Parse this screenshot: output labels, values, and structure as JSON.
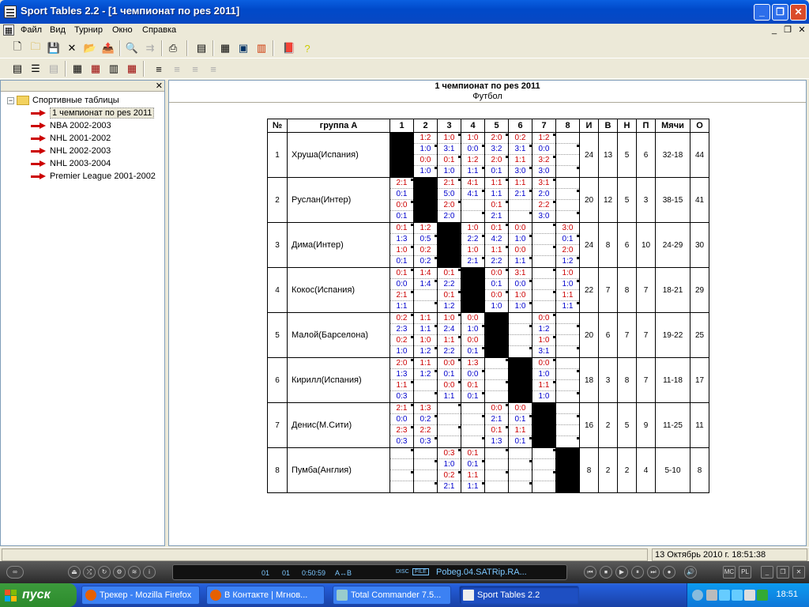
{
  "window": {
    "title": "Sport Tables 2.2 - [1 чемпионат по pes 2011]"
  },
  "menu": [
    "Файл",
    "Вид",
    "Турнир",
    "Окно",
    "Справка"
  ],
  "tree": {
    "root": "Спортивные таблицы",
    "items": [
      "1 чемпионат по pes 2011",
      "NBA 2002-2003",
      "NHL 2001-2002",
      "NHL 2002-2003",
      "NHL 2003-2004",
      "Premier League 2001-2002"
    ]
  },
  "doc": {
    "title": "1 чемпионат по pes 2011",
    "subtitle": "Футбол"
  },
  "table": {
    "headers": {
      "num": "№",
      "group": "группа А",
      "cols": [
        "1",
        "2",
        "3",
        "4",
        "5",
        "6",
        "7",
        "8"
      ],
      "games": "И",
      "wins": "В",
      "draws": "Н",
      "losses": "П",
      "goals": "Мячи",
      "points": "О"
    },
    "rows": [
      {
        "num": "1",
        "team": "Хруша(Испания)",
        "games": "24",
        "wins": "13",
        "draws": "5",
        "losses": "6",
        "goals": "32-18",
        "points": "44",
        "cells": [
          null,
          [
            "1:2",
            "1:0",
            "0:0",
            "1:0"
          ],
          [
            "1:0",
            "3:1",
            "0:1",
            "1:0"
          ],
          [
            "1:0",
            "0:0",
            "1:2",
            "1:1"
          ],
          [
            "2:0",
            "3:2",
            "2:0",
            "0:1"
          ],
          [
            "0:2",
            "3:1",
            "1:1",
            "3:0"
          ],
          [
            "1:2",
            "0:0",
            "3:2",
            "3:0"
          ],
          [
            "",
            "",
            "",
            ""
          ]
        ]
      },
      {
        "num": "2",
        "team": "Руслан(Интер)",
        "games": "20",
        "wins": "12",
        "draws": "5",
        "losses": "3",
        "goals": "38-15",
        "points": "41",
        "cells": [
          [
            "2:1",
            "0:1",
            "0:0",
            "0:1"
          ],
          null,
          [
            "2:1",
            "5:0",
            "2:0",
            "2:0"
          ],
          [
            "4:1",
            "4:1",
            "",
            ""
          ],
          [
            "1:1",
            "1:1",
            "0:1",
            "2:1"
          ],
          [
            "1:1",
            "2:1",
            "",
            ""
          ],
          [
            "3:1",
            "2:0",
            "2:2",
            "3:0"
          ],
          [
            "",
            "",
            "",
            ""
          ]
        ]
      },
      {
        "num": "3",
        "team": "Дима(Интер)",
        "games": "24",
        "wins": "8",
        "draws": "6",
        "losses": "10",
        "goals": "24-29",
        "points": "30",
        "cells": [
          [
            "0:1",
            "1:3",
            "1:0",
            "0:1"
          ],
          [
            "1:2",
            "0:5",
            "0:2",
            "0:2"
          ],
          null,
          [
            "1:0",
            "2:2",
            "1:0",
            "2:1"
          ],
          [
            "0:1",
            "4:2",
            "1:1",
            "2:2"
          ],
          [
            "0:0",
            "1:0",
            "0:0",
            "1:1"
          ],
          [
            "",
            "",
            "",
            ""
          ],
          [
            "3:0",
            "0:1",
            "2:0",
            "1:2"
          ]
        ]
      },
      {
        "num": "4",
        "team": "Кокос(Испания)",
        "games": "22",
        "wins": "7",
        "draws": "8",
        "losses": "7",
        "goals": "18-21",
        "points": "29",
        "cells": [
          [
            "0:1",
            "0:0",
            "2:1",
            "1:1"
          ],
          [
            "1:4",
            "1:4",
            "",
            ""
          ],
          [
            "0:1",
            "2:2",
            "0:1",
            "1:2"
          ],
          null,
          [
            "0:0",
            "0:1",
            "0:0",
            "1:0"
          ],
          [
            "3:1",
            "0:0",
            "1:0",
            "1:0"
          ],
          [
            "",
            "",
            "",
            ""
          ],
          [
            "1:0",
            "1:0",
            "1:1",
            "1:1"
          ]
        ]
      },
      {
        "num": "5",
        "team": "Малой(Барселона)",
        "games": "20",
        "wins": "6",
        "draws": "7",
        "losses": "7",
        "goals": "19-22",
        "points": "25",
        "cells": [
          [
            "0:2",
            "2:3",
            "0:2",
            "1:0"
          ],
          [
            "1:1",
            "1:1",
            "1:0",
            "1:2"
          ],
          [
            "1:0",
            "2:4",
            "1:1",
            "2:2"
          ],
          [
            "0:0",
            "1:0",
            "0:0",
            "0:1"
          ],
          null,
          [
            "",
            "",
            "",
            ""
          ],
          [
            "0:0",
            "1:2",
            "1:0",
            "3:1"
          ],
          [
            "",
            "",
            "",
            ""
          ]
        ]
      },
      {
        "num": "6",
        "team": "Кирилл(Испания)",
        "games": "18",
        "wins": "3",
        "draws": "8",
        "losses": "7",
        "goals": "11-18",
        "points": "17",
        "cells": [
          [
            "2:0",
            "1:3",
            "1:1",
            "0:3"
          ],
          [
            "1:1",
            "1:2",
            "",
            ""
          ],
          [
            "0:0",
            "0:1",
            "0:0",
            "1:1"
          ],
          [
            "1:3",
            "0:0",
            "0:1",
            "0:1"
          ],
          [
            "",
            "",
            "",
            ""
          ],
          null,
          [
            "0:0",
            "1:0",
            "1:1",
            "1:0"
          ],
          [
            "",
            "",
            "",
            ""
          ]
        ]
      },
      {
        "num": "7",
        "team": "Денис(М.Сити)",
        "games": "16",
        "wins": "2",
        "draws": "5",
        "losses": "9",
        "goals": "11-25",
        "points": "11",
        "cells": [
          [
            "2:1",
            "0:0",
            "2:3",
            "0:3"
          ],
          [
            "1:3",
            "0:2",
            "2:2",
            "0:3"
          ],
          [
            "",
            "",
            "",
            ""
          ],
          [
            "",
            "",
            "",
            ""
          ],
          [
            "0:0",
            "2:1",
            "0:1",
            "1:3"
          ],
          [
            "0:0",
            "0:1",
            "1:1",
            "0:1"
          ],
          null,
          [
            "",
            "",
            "",
            ""
          ]
        ]
      },
      {
        "num": "8",
        "team": "Пумба(Англия)",
        "games": "8",
        "wins": "2",
        "draws": "2",
        "losses": "4",
        "goals": "5-10",
        "points": "8",
        "cells": [
          [
            "",
            "",
            "",
            ""
          ],
          [
            "",
            "",
            "",
            ""
          ],
          [
            "0:3",
            "1:0",
            "0:2",
            "2:1"
          ],
          [
            "0:1",
            "0:1",
            "1:1",
            "1:1"
          ],
          [
            "",
            "",
            "",
            ""
          ],
          [
            "",
            "",
            "",
            ""
          ],
          [
            "",
            "",
            "",
            ""
          ],
          null
        ]
      }
    ]
  },
  "status": {
    "datetime": "13 Октябрь 2010 г. 18:51:38"
  },
  "player": {
    "track": "Pobeg.04.SATRip.RA...",
    "time": "0:50:59",
    "a": "01",
    "b": "01",
    "ab": "A↔B",
    "disc": "DISC",
    "file": "FILE"
  },
  "taskbar": {
    "start": "пуск",
    "tasks": [
      "Трекер - Mozilla Firefox",
      "В Контакте | Мгнов...",
      "Total Commander 7.5...",
      "Sport Tables 2.2"
    ],
    "clock": "18:51"
  },
  "colors": {
    "home": "#CC0000",
    "away": "#0000CC",
    "title_bar": "#0A5FE0",
    "taskbar": "#245EDB",
    "start": "#3C9B3C"
  }
}
